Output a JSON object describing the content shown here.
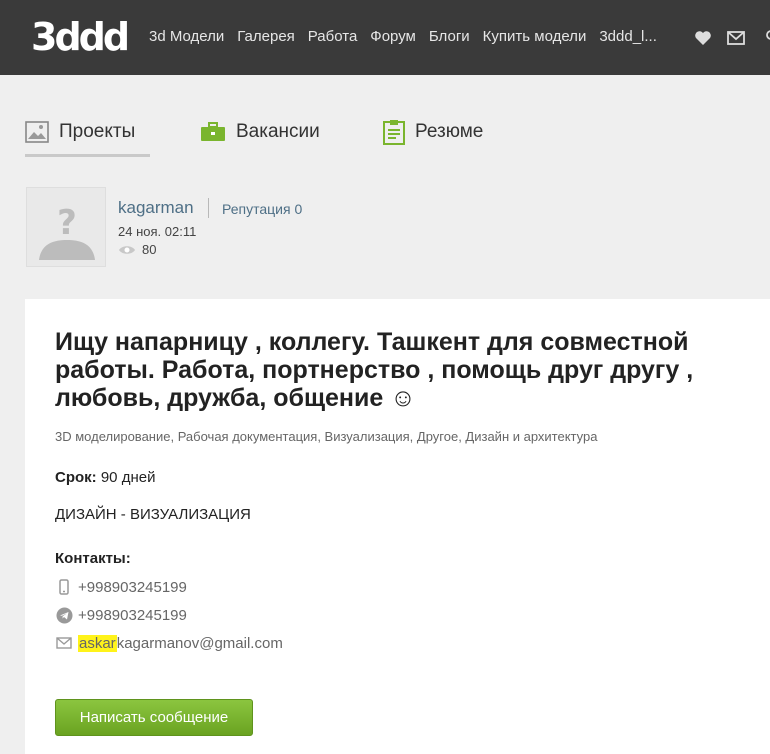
{
  "header": {
    "logo": "3ddd",
    "nav": [
      {
        "label": "3d Модели"
      },
      {
        "label": "Галерея"
      },
      {
        "label": "Работа"
      },
      {
        "label": "Форум"
      },
      {
        "label": "Блоги"
      },
      {
        "label": "Купить модели"
      },
      {
        "label": "3ddd_l..."
      }
    ]
  },
  "tabs": [
    {
      "label": "Проекты",
      "icon": "image-icon",
      "active": true
    },
    {
      "label": "Вакансии",
      "icon": "briefcase-icon",
      "active": false
    },
    {
      "label": "Резюме",
      "icon": "clipboard-icon",
      "active": false
    }
  ],
  "author": {
    "name": "kagarman",
    "reputation": "Репутация 0",
    "date": "24 ноя. 02:11",
    "views": "80"
  },
  "post": {
    "title": "Ищу напарницу , коллегу. Ташкент для совместной работы. Работа, портнерство , помощь друг другу , любовь, дружба, общение ☺",
    "categories": "3D моделирование, Рабочая документация, Визуализация, Другое, Дизайн и архитектура",
    "term_label": "Срок:",
    "term_value": "90 дней",
    "description": "ДИЗАЙН - ВИЗУАЛИЗАЦИЯ",
    "contacts_title": "Контакты:",
    "phone": "+998903245199",
    "telegram": "+998903245199",
    "email_highlight": "askar",
    "email_rest": "kagarmanov@gmail.com",
    "send_button": "Написать сообщение"
  },
  "colors": {
    "topbar": "#3a3a3a",
    "link": "#4e6f86",
    "button_green": "#7ab52e",
    "highlight": "#fff31a",
    "tab_icon_green": "#7ab52e"
  }
}
